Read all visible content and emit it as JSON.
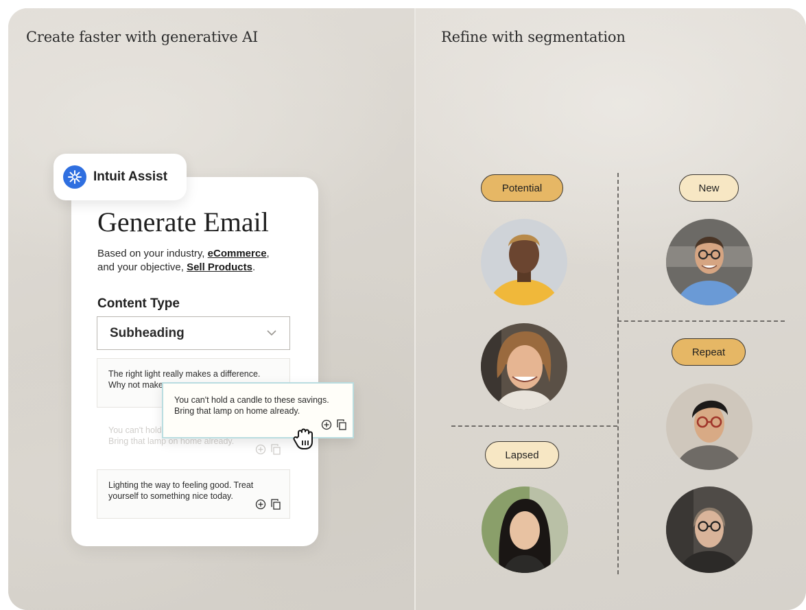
{
  "left_panel": {
    "title": "Create faster with generative AI",
    "assist": {
      "label": "Intuit Assist",
      "icon": "intuit-assist-logo-icon"
    },
    "card": {
      "title": "Generate Email",
      "description_prefix": "Based on your industry, ",
      "industry": "eCommerce",
      "description_middle": ",\nand your objective, ",
      "objective": "Sell Products",
      "description_suffix": ".",
      "content_type_label": "Content Type",
      "content_type_value": "Subheading",
      "options": [
        {
          "text": "The right light really makes a difference. Why not make"
        },
        {
          "text": "You can't hold a candle to these savings. Bring that lamp on home already."
        },
        {
          "text": "Lighting the way to feeling good. Treat yourself to something nice today."
        }
      ],
      "popup_text": "You can't hold a candle to these savings. Bring that lamp on home already."
    }
  },
  "right_panel": {
    "title": "Refine with segmentation",
    "segments": [
      {
        "label": "Potential",
        "style": "gold"
      },
      {
        "label": "New",
        "style": "cream"
      },
      {
        "label": "Repeat",
        "style": "gold"
      },
      {
        "label": "Lapsed",
        "style": "cream"
      }
    ]
  },
  "colors": {
    "tag_gold": "#e6b765",
    "tag_cream": "#f7e7c4",
    "assist_blue": "#2f6fe0",
    "popup_border": "#b9dde0"
  }
}
